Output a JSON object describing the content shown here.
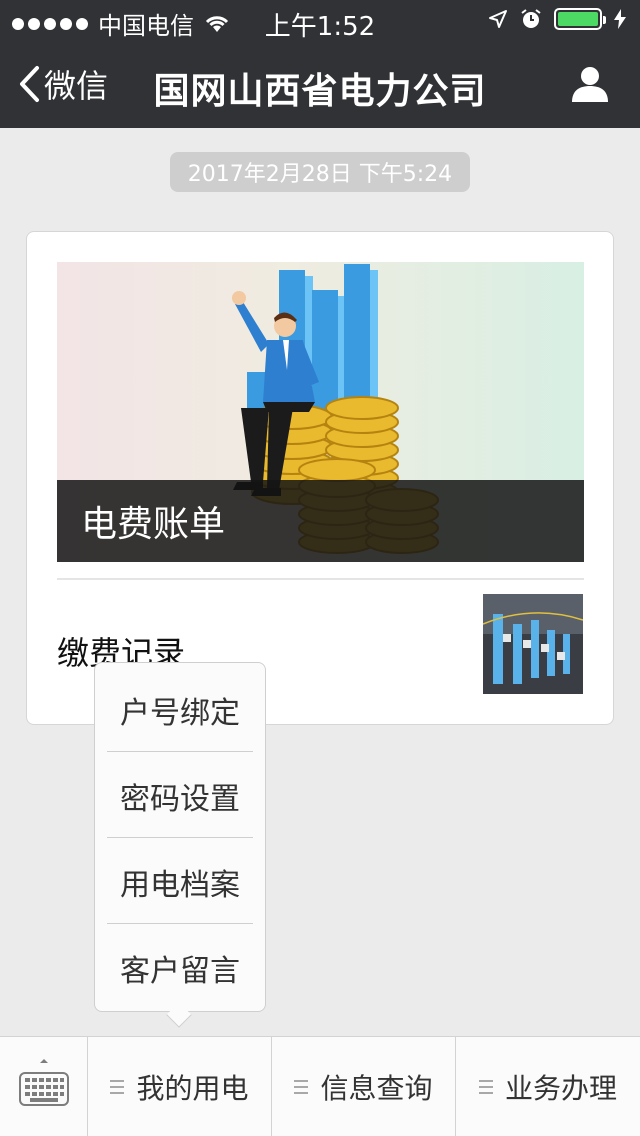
{
  "status": {
    "carrier": "中国电信",
    "time": "上午1:52"
  },
  "nav": {
    "back_label": "微信",
    "title": "国网山西省电力公司"
  },
  "timestamp": "2017年2月28日 下午5:24",
  "card": {
    "cover_title": "电费账单",
    "sub_title": "缴费记录"
  },
  "popup_menu": {
    "items": [
      "户号绑定",
      "密码设置",
      "用电档案",
      "客户留言"
    ]
  },
  "bottom_bar": {
    "tabs": [
      "我的用电",
      "信息查询",
      "业务办理"
    ]
  },
  "icons": {
    "back": "chevron-left-icon",
    "profile": "person-icon",
    "keyboard": "keyboard-icon",
    "menu": "menu-lines-icon",
    "wifi": "wifi-icon",
    "location": "location-arrow-icon",
    "alarm": "alarm-clock-icon",
    "battery": "battery-icon",
    "charging": "charging-bolt-icon"
  },
  "colors": {
    "topbar": "#303236",
    "background": "#ebebeb",
    "battery_fill": "#4cd964"
  }
}
